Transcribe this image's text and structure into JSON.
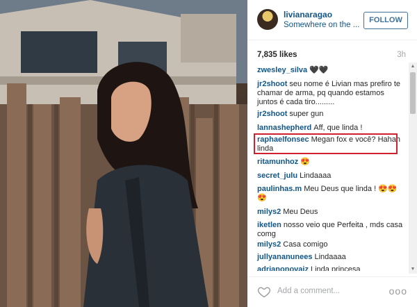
{
  "post": {
    "username": "livianaragao",
    "location": "Somewhere on the ...",
    "follow_label": "FOLLOW",
    "likes": "7,835 likes",
    "time": "3h"
  },
  "comments": [
    {
      "user": "zwesley_silva",
      "text": "🖤🖤"
    },
    {
      "user": "jr2shoot",
      "text": "seu nome é Livian mas prefiro te chamar de arma, pq quando estamos juntos é cada tiro.........",
      "lines": [
        "seu nome é Livian mas prefiro",
        "te chamar de arma, pq quando estamos",
        "juntos é cada tiro........."
      ]
    },
    {
      "user": "jr2shoot",
      "text": "super gun"
    },
    {
      "user": "lannashepherd",
      "text": "Aff, que linda !"
    },
    {
      "user": "raphaelfonsec",
      "text": "Megan fox e você? Hahah linda"
    },
    {
      "user": "ritamunhoz",
      "text": "😍"
    },
    {
      "user": "secret_julu",
      "text": "Lindaaaa"
    },
    {
      "user": "paulinhas.m",
      "text": "Meu Deus que linda ! 😍😍😍"
    },
    {
      "user": "milys2",
      "text": "Meu Deus"
    },
    {
      "user": "iketlen",
      "text": "nosso veio que Perfeita , mds casa comg"
    },
    {
      "user": "milys2",
      "text": "Casa comigo"
    },
    {
      "user": "jullyananunees",
      "text": "Lindaaaa"
    },
    {
      "user": "adrianonovaiz",
      "text": "Linda princesa"
    }
  ],
  "footer": {
    "add_comment_placeholder": "Add a comment...",
    "more_label": "ooo"
  },
  "colors": {
    "link": "#125688",
    "follow": "#3f729b",
    "highlight": "#d0202d"
  },
  "icons": [
    "heart-icon",
    "more-options-icon",
    "scroll-up-icon",
    "scroll-down-icon"
  ]
}
